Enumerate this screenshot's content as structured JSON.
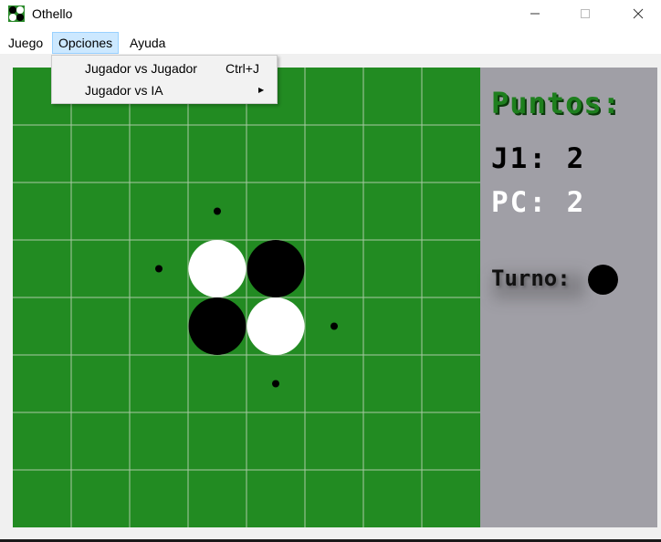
{
  "window": {
    "title": "Othello",
    "icon": "othello-app-icon",
    "controls": [
      "minimize-icon",
      "maximize-icon",
      "close-icon"
    ]
  },
  "menubar": {
    "items": [
      {
        "label": "Juego"
      },
      {
        "label": "Opciones",
        "active": true
      },
      {
        "label": "Ayuda"
      }
    ]
  },
  "dropdown": {
    "items": [
      {
        "label": "Jugador vs Jugador",
        "shortcut": "Ctrl+J",
        "submenu": false
      },
      {
        "label": "Jugador vs IA",
        "shortcut": "",
        "submenu": true
      }
    ]
  },
  "board": {
    "columns": 8,
    "rows": 8,
    "pieces": [
      {
        "row": 3,
        "col": 3,
        "color": "white"
      },
      {
        "row": 3,
        "col": 4,
        "color": "black"
      },
      {
        "row": 4,
        "col": 3,
        "color": "black"
      },
      {
        "row": 4,
        "col": 4,
        "color": "white"
      }
    ],
    "valid_moves": [
      {
        "row": 2,
        "col": 3
      },
      {
        "row": 3,
        "col": 2
      },
      {
        "row": 4,
        "col": 5
      },
      {
        "row": 5,
        "col": 4
      }
    ],
    "colors": {
      "board": "#228b22",
      "grid": "#a9c9a4"
    }
  },
  "score": {
    "title": "Puntos:",
    "j1_label": "J1:",
    "j1_value": "2",
    "pc_label": "PC:",
    "pc_value": "2",
    "turn_label": "Turno:",
    "turn_color": "black"
  },
  "colors": {
    "panel": "#a09fa6",
    "title_green": "#1e7f1e",
    "menu_highlight": "#cce8ff"
  }
}
